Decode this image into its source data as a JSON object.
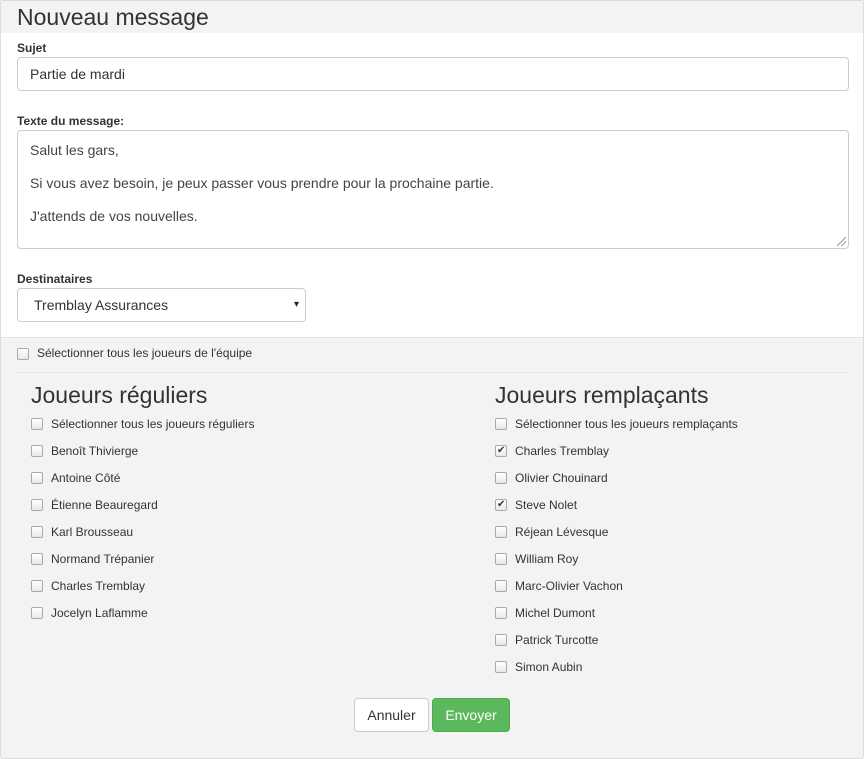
{
  "dialog": {
    "title": "Nouveau message"
  },
  "subject": {
    "label": "Sujet",
    "value": "Partie de mardi"
  },
  "message": {
    "label": "Texte du message:",
    "lines": [
      "Salut les gars,",
      "Si vous avez besoin, je peux passer vous prendre pour la prochaine partie.",
      "J'attends de vos nouvelles."
    ]
  },
  "recipients": {
    "label": "Destinataires",
    "selected": "Tremblay Assurances",
    "caret": "▾"
  },
  "select_all_team": {
    "label": "Sélectionner tous les joueurs de l'équipe",
    "checked": false
  },
  "regular": {
    "title": "Joueurs réguliers",
    "items": [
      {
        "label": "Sélectionner tous les joueurs réguliers",
        "checked": false
      },
      {
        "label": "Benoît Thivierge",
        "checked": false
      },
      {
        "label": "Antoine Côté",
        "checked": false
      },
      {
        "label": "Étienne Beauregard",
        "checked": false
      },
      {
        "label": "Karl Brousseau",
        "checked": false
      },
      {
        "label": "Normand Trépanier",
        "checked": false
      },
      {
        "label": "Charles Tremblay",
        "checked": false
      },
      {
        "label": "Jocelyn Laflamme",
        "checked": false
      }
    ]
  },
  "substitutes": {
    "title": "Joueurs remplaçants",
    "items": [
      {
        "label": "Sélectionner tous les joueurs remplaçants",
        "checked": false
      },
      {
        "label": "Charles Tremblay",
        "checked": true
      },
      {
        "label": "Olivier Chouinard",
        "checked": false
      },
      {
        "label": "Steve Nolet",
        "checked": true
      },
      {
        "label": "Réjean Lévesque",
        "checked": false
      },
      {
        "label": "William Roy",
        "checked": false
      },
      {
        "label": "Marc-Olivier Vachon",
        "checked": false
      },
      {
        "label": "Michel Dumont",
        "checked": false
      },
      {
        "label": "Patrick Turcotte",
        "checked": false
      },
      {
        "label": "Simon Aubin",
        "checked": false
      }
    ]
  },
  "actions": {
    "cancel_label": "Annuler",
    "send_label": "Envoyer"
  },
  "colors": {
    "send_button": "#5cb85c",
    "panel_background": "#f3f3f3"
  }
}
